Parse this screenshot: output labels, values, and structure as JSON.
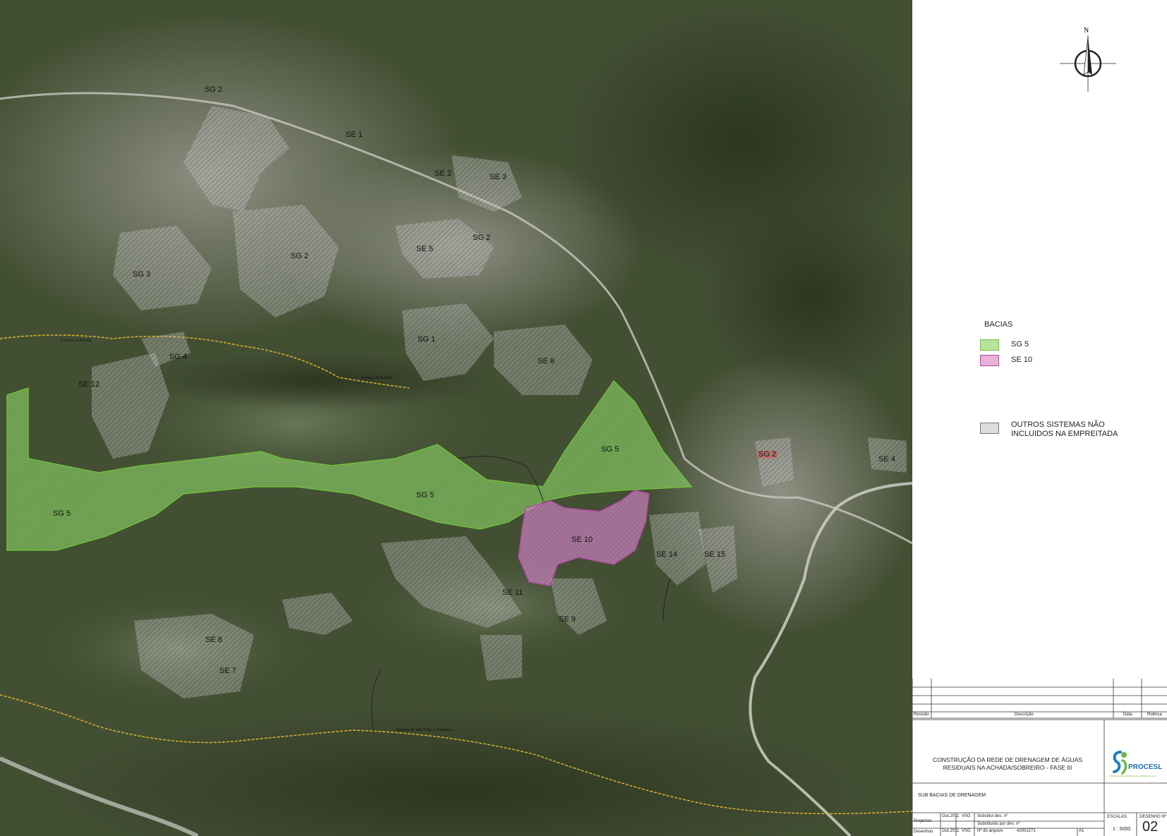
{
  "map": {
    "labels": [
      {
        "text": "SG 2"
      },
      {
        "text": "SE 1"
      },
      {
        "text": "SE 2"
      },
      {
        "text": "SE 3"
      },
      {
        "text": "SE 5"
      },
      {
        "text": "SG 2"
      },
      {
        "text": "SG 2"
      },
      {
        "text": "SG 3"
      },
      {
        "text": "SG 1"
      },
      {
        "text": "SG 4"
      },
      {
        "text": "SE 6"
      },
      {
        "text": "SE 12"
      },
      {
        "text": "SG 5"
      },
      {
        "text": "SG 2"
      },
      {
        "text": "SE 4"
      },
      {
        "text": "SG 5"
      },
      {
        "text": "SG 5"
      },
      {
        "text": "SE 10"
      },
      {
        "text": "SE 14"
      },
      {
        "text": "SE 15"
      },
      {
        "text": "SE 11"
      },
      {
        "text": "SE 9"
      },
      {
        "text": "SE 8"
      },
      {
        "text": "SE 7"
      }
    ],
    "boundary_labels": [
      {
        "text": "Estremo da Achada"
      },
      {
        "text": "Estremo da Achada"
      },
      {
        "text": "Estremo de Vale Pisão e Videgosos"
      }
    ]
  },
  "legend": {
    "title": "BACIAS",
    "items": [
      {
        "label": "SG 5",
        "color": "#b8e39a"
      },
      {
        "label": "SE 10",
        "color": "#e8b2d6"
      },
      {
        "label": "OUTROS SISTEMAS NÃO INCLUIDOS NA EMPREITADA",
        "color": "#dcdcdc"
      }
    ]
  },
  "north_arrow": {
    "label": "N"
  },
  "title_block": {
    "rev_headers": {
      "revisao": "Revisão",
      "descricao": "Descrição",
      "data": "Data",
      "rubrica": "Rúbrica"
    },
    "project_title": "CONSTRUÇÃO DA REDE DE DRENAGEM DE ÁGUAS RESIDUAIS NA ACHADA/SOBREIRO - FASE III",
    "drawing_title": "SUB BACIAS DE DRENAGEM",
    "company": "PROCESL",
    "company_sub": "ENGENHARIA HIDRÁULICA E AMBIENTAL, LDA",
    "rows": [
      {
        "role": "Projectou",
        "date": "Out.2011",
        "who": "VSG",
        "field": "Substitui des. nº",
        "value": ""
      },
      {
        "role": "",
        "date": "",
        "who": "",
        "field": "Substituído por des. nº",
        "value": ""
      },
      {
        "role": "Desenhou",
        "date": "Out.2011",
        "who": "VSG",
        "field": "Nº do arquivo",
        "value": "42002271"
      }
    ],
    "format": "A1",
    "scale_label": "ESCALAS:",
    "scale": "1 : 5000",
    "drawing_no_label": "DESENHO Nº",
    "drawing_no": "02"
  }
}
